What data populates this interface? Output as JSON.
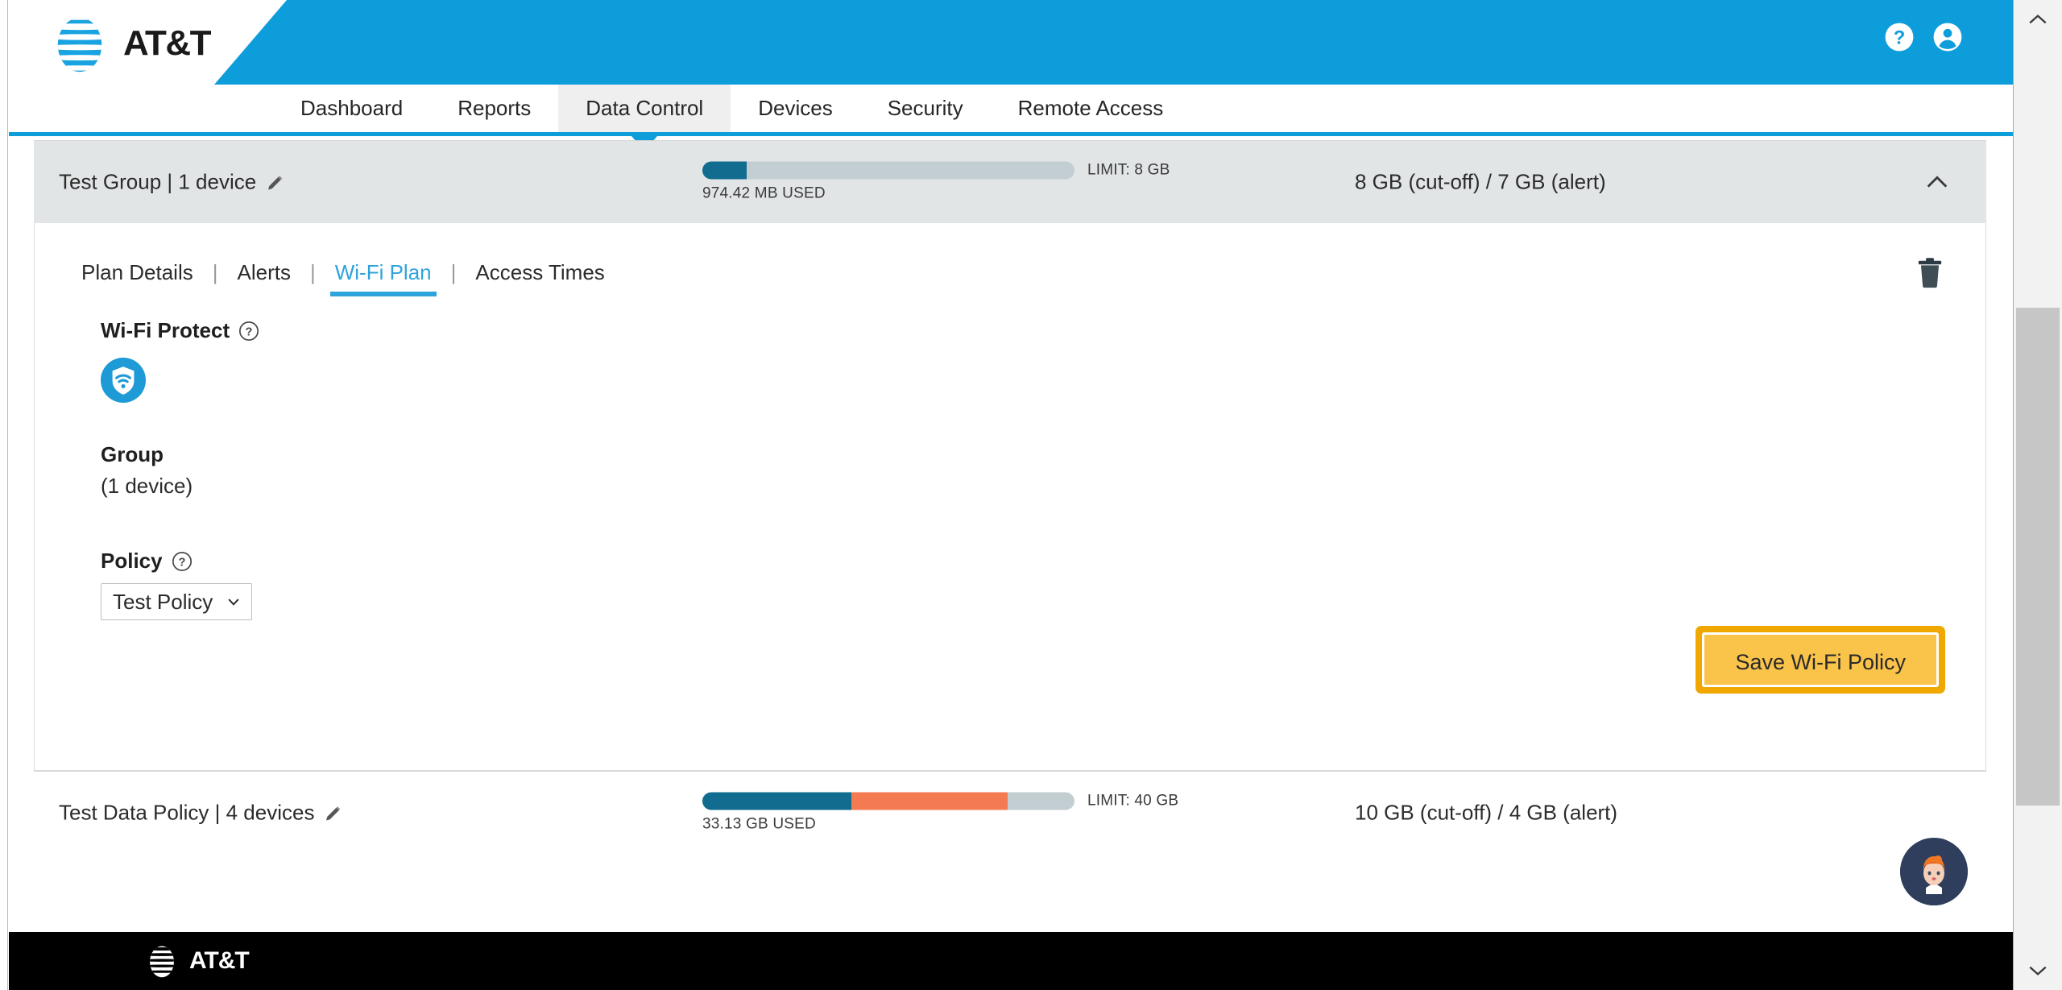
{
  "brand": {
    "name": "AT&T",
    "accent_blue": "#0d9ddb",
    "footer_bg": "#000000"
  },
  "header": {
    "help_icon": "help-circle-icon",
    "account_icon": "user-account-icon"
  },
  "nav": {
    "items": [
      {
        "label": "Dashboard",
        "active": false
      },
      {
        "label": "Reports",
        "active": false
      },
      {
        "label": "Data Control",
        "active": true
      },
      {
        "label": "Devices",
        "active": false
      },
      {
        "label": "Security",
        "active": false
      },
      {
        "label": "Remote Access",
        "active": false
      }
    ]
  },
  "groups": [
    {
      "title": "Test Group | 1 device",
      "edit_icon": "pencil-icon",
      "used_label": "974.42 MB USED",
      "limit_label": "LIMIT: 8 GB",
      "thresholds": "8 GB (cut-off) / 7 GB (alert)",
      "collapse_icon": "chevron-up-icon",
      "bar": {
        "blue_pct": 12,
        "orange_pct": 0,
        "track_color": "#c3ced3",
        "blue_color": "#116c90",
        "orange_color": "#f47a51"
      },
      "expanded": true
    },
    {
      "title": "Test Data Policy | 4 devices",
      "edit_icon": "pencil-icon",
      "used_label": "33.13 GB USED",
      "limit_label": "LIMIT: 40 GB",
      "thresholds": "10 GB (cut-off) / 4 GB (alert)",
      "bar": {
        "blue_pct": 40,
        "orange_pct": 42,
        "track_color": "#c3ced3",
        "blue_color": "#116c90",
        "orange_color": "#f47a51"
      },
      "expanded": false
    }
  ],
  "panel": {
    "tabs": [
      {
        "label": "Plan Details",
        "active": false
      },
      {
        "label": "Alerts",
        "active": false
      },
      {
        "label": "Wi-Fi Plan",
        "active": true
      },
      {
        "label": "Access Times",
        "active": false
      }
    ],
    "tab_separator": "|",
    "delete_icon": "trash-icon",
    "wifi_protect": {
      "label": "Wi-Fi Protect",
      "help_icon": "help-circle-icon",
      "badge_icon": "wifi-shield-icon",
      "badge_color": "#2196d6"
    },
    "group": {
      "label": "Group",
      "value": "(1 device)"
    },
    "policy": {
      "label": "Policy",
      "help_icon": "help-circle-icon",
      "selected": "Test Policy",
      "options": [
        "Test Policy"
      ],
      "chevron_icon": "chevron-down-icon"
    },
    "save_button": {
      "label": "Save Wi-Fi Policy",
      "fill": "#fac349",
      "focus_ring": "#f0a800"
    }
  },
  "chat": {
    "avatar_name": "chat-assistant-avatar"
  },
  "footer": {
    "brand": "AT&T"
  },
  "scrollbar": {
    "up_icon": "chevron-up-icon",
    "down_icon": "chevron-down-icon"
  }
}
